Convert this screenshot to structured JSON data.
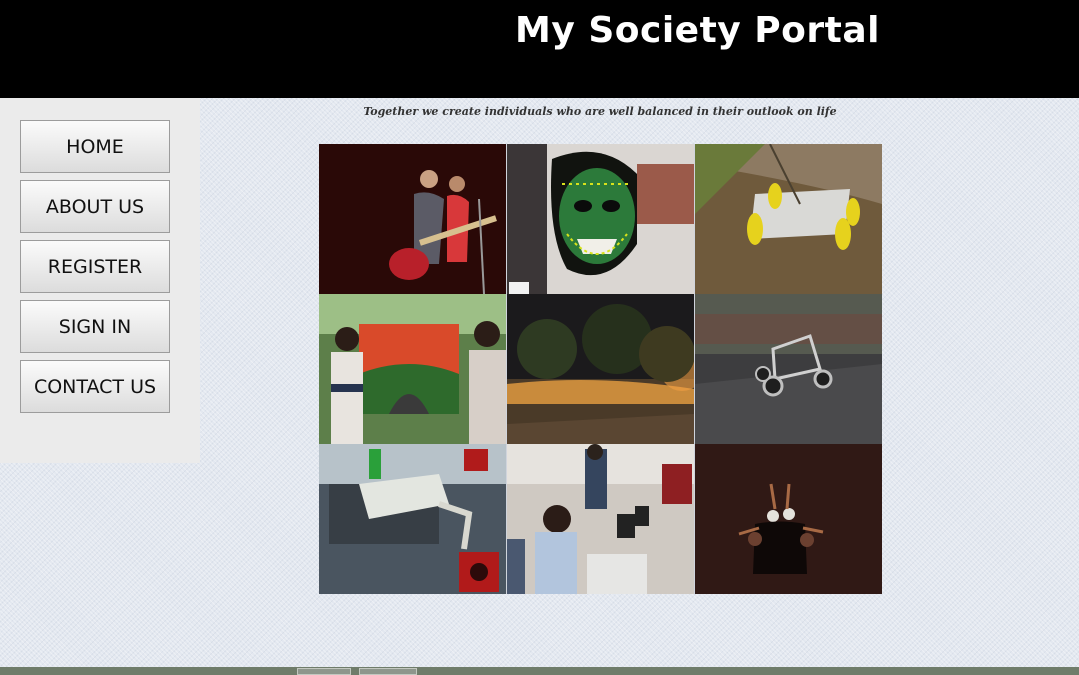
{
  "header": {
    "title": "My Society Portal"
  },
  "nav": [
    {
      "label": "HOME"
    },
    {
      "label": "ABOUT US"
    },
    {
      "label": "REGISTER"
    },
    {
      "label": "SIGN IN"
    },
    {
      "label": "CONTACT US"
    }
  ],
  "tagline": "Together we create individuals who are well balanced in their outlook on life",
  "gallery": [
    {
      "subject": "musicians-on-stage"
    },
    {
      "subject": "face-painted-student"
    },
    {
      "subject": "rover-robot"
    },
    {
      "subject": "students-with-painting"
    },
    {
      "subject": "campus-at-night"
    },
    {
      "subject": "buggy-vehicle"
    },
    {
      "subject": "robotic-arm"
    },
    {
      "subject": "computer-lab"
    },
    {
      "subject": "dance-performance"
    }
  ],
  "colors": {
    "header_bg": "#000000",
    "header_text": "#ffffff",
    "sidebar_bg": "#ebebeb",
    "page_bg": "#e3e8f0"
  }
}
